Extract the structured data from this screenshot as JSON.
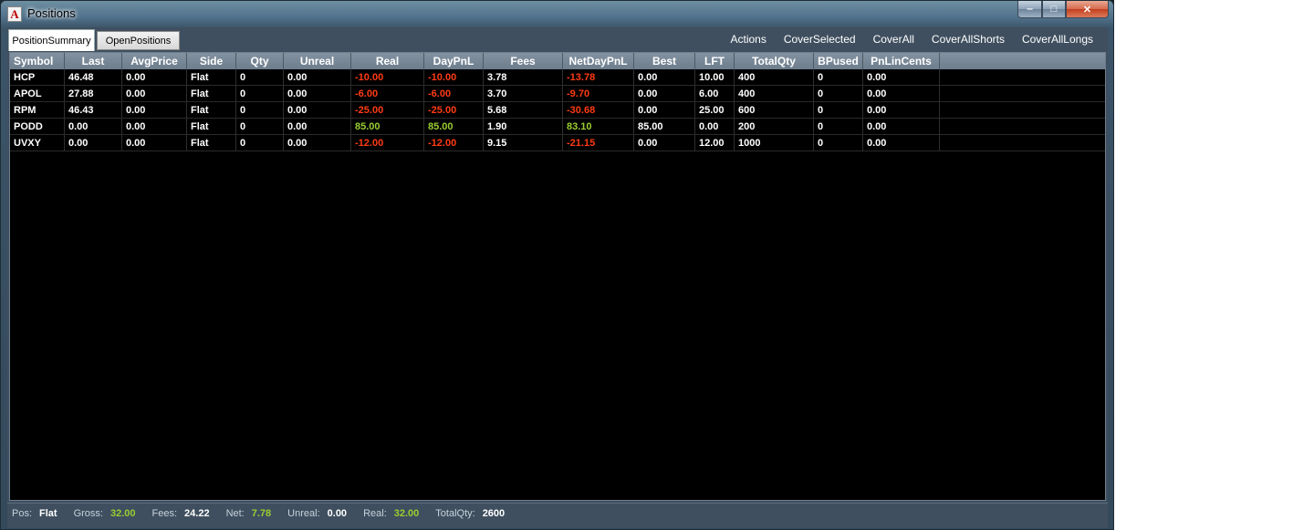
{
  "window": {
    "title": "Positions",
    "icon": "app-logo-icon",
    "app_logo_letter": "A"
  },
  "tabs": [
    {
      "label": "PositionSummary",
      "active": true
    },
    {
      "label": "OpenPositions",
      "active": false
    }
  ],
  "actions": [
    "Actions",
    "CoverSelected",
    "CoverAll",
    "CoverAllShorts",
    "CoverAllLongs"
  ],
  "table": {
    "columns": [
      "Symbol",
      "Last",
      "AvgPrice",
      "Side",
      "Qty",
      "Unreal",
      "Real",
      "DayPnL",
      "Fees",
      "NetDayPnL",
      "Best",
      "LFT",
      "TotalQty",
      "BPused",
      "PnLinCents"
    ],
    "rows": [
      [
        "HCP",
        "46.48",
        "0.00",
        "Flat",
        "0",
        "0.00",
        "-10.00",
        "-10.00",
        "3.78",
        "-13.78",
        "0.00",
        "10.00",
        "400",
        "0",
        "0.00"
      ],
      [
        "APOL",
        "27.88",
        "0.00",
        "Flat",
        "0",
        "0.00",
        "-6.00",
        "-6.00",
        "3.70",
        "-9.70",
        "0.00",
        "6.00",
        "400",
        "0",
        "0.00"
      ],
      [
        "RPM",
        "46.43",
        "0.00",
        "Flat",
        "0",
        "0.00",
        "-25.00",
        "-25.00",
        "5.68",
        "-30.68",
        "0.00",
        "25.00",
        "600",
        "0",
        "0.00"
      ],
      [
        "PODD",
        "0.00",
        "0.00",
        "Flat",
        "0",
        "0.00",
        "85.00",
        "85.00",
        "1.90",
        "83.10",
        "85.00",
        "0.00",
        "200",
        "0",
        "0.00"
      ],
      [
        "UVXY",
        "0.00",
        "0.00",
        "Flat",
        "0",
        "0.00",
        "-12.00",
        "-12.00",
        "9.15",
        "-21.15",
        "0.00",
        "12.00",
        "1000",
        "0",
        "0.00"
      ]
    ]
  },
  "status": {
    "pos_label": "Pos:",
    "pos_value": "Flat",
    "gross_label": "Gross:",
    "gross_value": "32.00",
    "fees_label": "Fees:",
    "fees_value": "24.22",
    "net_label": "Net:",
    "net_value": "7.78",
    "unreal_label": "Unreal:",
    "unreal_value": "0.00",
    "real_label": "Real:",
    "real_value": "32.00",
    "totalqty_label": "TotalQty:",
    "totalqty_value": "2600"
  },
  "colors": {
    "negative": "#ff3b14",
    "positive": "#9acd32",
    "grid_bg": "#000000",
    "header_bg": "#6d7d8c"
  }
}
